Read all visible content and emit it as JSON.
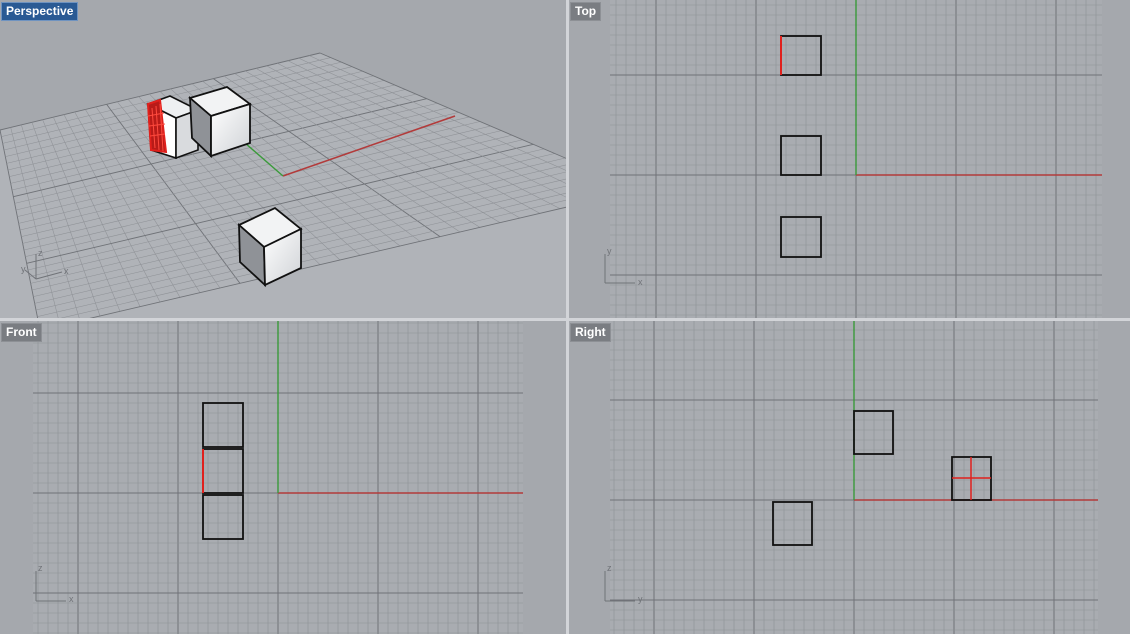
{
  "viewports": {
    "perspective": {
      "title": "Perspective",
      "active": true
    },
    "top": {
      "title": "Top",
      "active": false
    },
    "front": {
      "title": "Front",
      "active": false
    },
    "right": {
      "title": "Right",
      "active": false
    }
  },
  "axis_labels": {
    "perspective": {
      "horizontal": "x",
      "vertical": "z",
      "depth": "y"
    },
    "top": {
      "horizontal": "x",
      "vertical": "y"
    },
    "front": {
      "horizontal": "x",
      "vertical": "z"
    },
    "right": {
      "horizontal": "y",
      "vertical": "z"
    }
  },
  "colors": {
    "viewport_bg": "#a5a8ad",
    "grid_minor": "#8e9196",
    "grid_major": "#6f7277",
    "x_axis": "#b23b3b",
    "y_axis": "#3a9a3a",
    "selection": "#e0201c",
    "active_title": "#2a5a94"
  }
}
